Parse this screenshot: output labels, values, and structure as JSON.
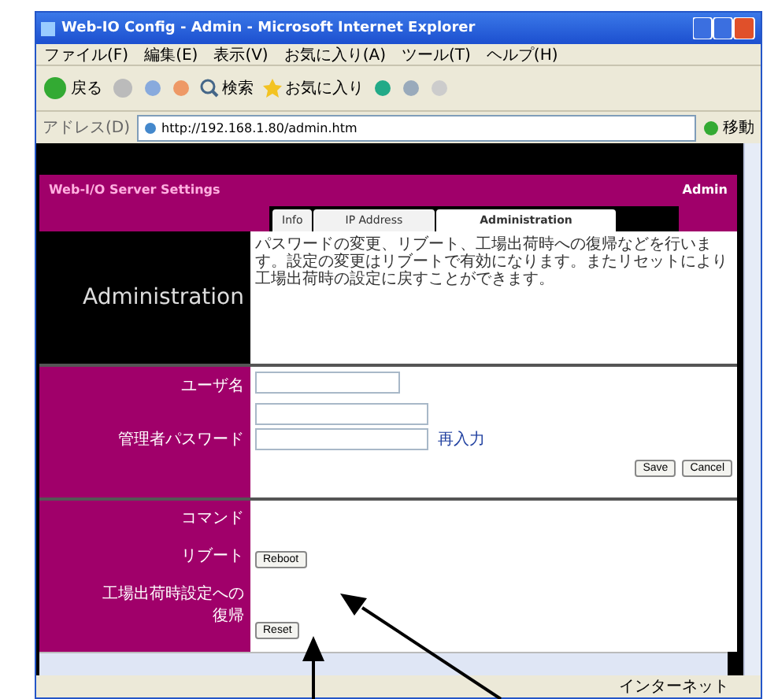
{
  "window": {
    "title": "Web-IO Config - Admin - Microsoft Internet Explorer"
  },
  "menu": [
    "ファイル(F)",
    "編集(E)",
    "表示(V)",
    "お気に入り(A)",
    "ツール(T)",
    "ヘルプ(H)"
  ],
  "toolbar": {
    "back": "戻る",
    "search": "検索",
    "favorites": "お気に入り"
  },
  "address": {
    "label": "アドレス(D)",
    "value": "http://192.168.1.80/admin.htm",
    "go": "移動"
  },
  "header": {
    "title": "Web-I/O Server Settings",
    "right": "Admin"
  },
  "tabs": [
    {
      "label": "Info",
      "selected": false
    },
    {
      "label": "IP Address",
      "selected": false
    },
    {
      "label": "Administration",
      "selected": true
    }
  ],
  "section_title": "Administration",
  "description": "パスワードの変更、リブート、工場出荷時への復帰などを行います。設定の変更はリブートで有効になります。またリセットにより工場出荷時の設定に戻すことができます。",
  "form": {
    "username_label": "ユーザ名",
    "password_label": "管理者パスワード",
    "reenter": "再入力",
    "buttons": [
      "Save",
      "Cancel"
    ]
  },
  "commands": {
    "title": "コマンド",
    "rows": [
      {
        "label": "リブート",
        "button": "Reboot"
      },
      {
        "label": "工場出荷時設定への復帰",
        "button": "Reset"
      }
    ]
  },
  "status_bar": {
    "zone": "インターネット"
  }
}
